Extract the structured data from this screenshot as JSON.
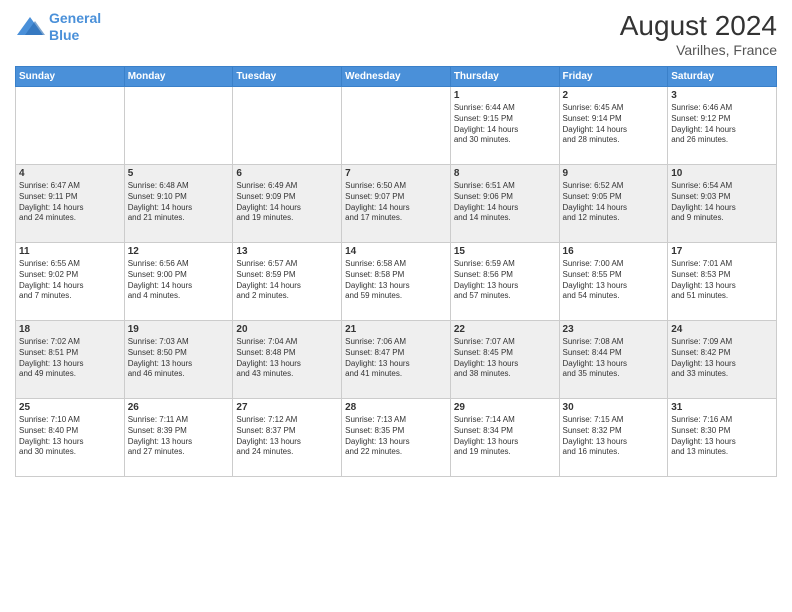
{
  "header": {
    "logo_line1": "General",
    "logo_line2": "Blue",
    "month_year": "August 2024",
    "location": "Varilhes, France"
  },
  "days_of_week": [
    "Sunday",
    "Monday",
    "Tuesday",
    "Wednesday",
    "Thursday",
    "Friday",
    "Saturday"
  ],
  "weeks": [
    [
      {
        "day": "",
        "info": ""
      },
      {
        "day": "",
        "info": ""
      },
      {
        "day": "",
        "info": ""
      },
      {
        "day": "",
        "info": ""
      },
      {
        "day": "1",
        "info": "Sunrise: 6:44 AM\nSunset: 9:15 PM\nDaylight: 14 hours\nand 30 minutes."
      },
      {
        "day": "2",
        "info": "Sunrise: 6:45 AM\nSunset: 9:14 PM\nDaylight: 14 hours\nand 28 minutes."
      },
      {
        "day": "3",
        "info": "Sunrise: 6:46 AM\nSunset: 9:12 PM\nDaylight: 14 hours\nand 26 minutes."
      }
    ],
    [
      {
        "day": "4",
        "info": "Sunrise: 6:47 AM\nSunset: 9:11 PM\nDaylight: 14 hours\nand 24 minutes."
      },
      {
        "day": "5",
        "info": "Sunrise: 6:48 AM\nSunset: 9:10 PM\nDaylight: 14 hours\nand 21 minutes."
      },
      {
        "day": "6",
        "info": "Sunrise: 6:49 AM\nSunset: 9:09 PM\nDaylight: 14 hours\nand 19 minutes."
      },
      {
        "day": "7",
        "info": "Sunrise: 6:50 AM\nSunset: 9:07 PM\nDaylight: 14 hours\nand 17 minutes."
      },
      {
        "day": "8",
        "info": "Sunrise: 6:51 AM\nSunset: 9:06 PM\nDaylight: 14 hours\nand 14 minutes."
      },
      {
        "day": "9",
        "info": "Sunrise: 6:52 AM\nSunset: 9:05 PM\nDaylight: 14 hours\nand 12 minutes."
      },
      {
        "day": "10",
        "info": "Sunrise: 6:54 AM\nSunset: 9:03 PM\nDaylight: 14 hours\nand 9 minutes."
      }
    ],
    [
      {
        "day": "11",
        "info": "Sunrise: 6:55 AM\nSunset: 9:02 PM\nDaylight: 14 hours\nand 7 minutes."
      },
      {
        "day": "12",
        "info": "Sunrise: 6:56 AM\nSunset: 9:00 PM\nDaylight: 14 hours\nand 4 minutes."
      },
      {
        "day": "13",
        "info": "Sunrise: 6:57 AM\nSunset: 8:59 PM\nDaylight: 14 hours\nand 2 minutes."
      },
      {
        "day": "14",
        "info": "Sunrise: 6:58 AM\nSunset: 8:58 PM\nDaylight: 13 hours\nand 59 minutes."
      },
      {
        "day": "15",
        "info": "Sunrise: 6:59 AM\nSunset: 8:56 PM\nDaylight: 13 hours\nand 57 minutes."
      },
      {
        "day": "16",
        "info": "Sunrise: 7:00 AM\nSunset: 8:55 PM\nDaylight: 13 hours\nand 54 minutes."
      },
      {
        "day": "17",
        "info": "Sunrise: 7:01 AM\nSunset: 8:53 PM\nDaylight: 13 hours\nand 51 minutes."
      }
    ],
    [
      {
        "day": "18",
        "info": "Sunrise: 7:02 AM\nSunset: 8:51 PM\nDaylight: 13 hours\nand 49 minutes."
      },
      {
        "day": "19",
        "info": "Sunrise: 7:03 AM\nSunset: 8:50 PM\nDaylight: 13 hours\nand 46 minutes."
      },
      {
        "day": "20",
        "info": "Sunrise: 7:04 AM\nSunset: 8:48 PM\nDaylight: 13 hours\nand 43 minutes."
      },
      {
        "day": "21",
        "info": "Sunrise: 7:06 AM\nSunset: 8:47 PM\nDaylight: 13 hours\nand 41 minutes."
      },
      {
        "day": "22",
        "info": "Sunrise: 7:07 AM\nSunset: 8:45 PM\nDaylight: 13 hours\nand 38 minutes."
      },
      {
        "day": "23",
        "info": "Sunrise: 7:08 AM\nSunset: 8:44 PM\nDaylight: 13 hours\nand 35 minutes."
      },
      {
        "day": "24",
        "info": "Sunrise: 7:09 AM\nSunset: 8:42 PM\nDaylight: 13 hours\nand 33 minutes."
      }
    ],
    [
      {
        "day": "25",
        "info": "Sunrise: 7:10 AM\nSunset: 8:40 PM\nDaylight: 13 hours\nand 30 minutes."
      },
      {
        "day": "26",
        "info": "Sunrise: 7:11 AM\nSunset: 8:39 PM\nDaylight: 13 hours\nand 27 minutes."
      },
      {
        "day": "27",
        "info": "Sunrise: 7:12 AM\nSunset: 8:37 PM\nDaylight: 13 hours\nand 24 minutes."
      },
      {
        "day": "28",
        "info": "Sunrise: 7:13 AM\nSunset: 8:35 PM\nDaylight: 13 hours\nand 22 minutes."
      },
      {
        "day": "29",
        "info": "Sunrise: 7:14 AM\nSunset: 8:34 PM\nDaylight: 13 hours\nand 19 minutes."
      },
      {
        "day": "30",
        "info": "Sunrise: 7:15 AM\nSunset: 8:32 PM\nDaylight: 13 hours\nand 16 minutes."
      },
      {
        "day": "31",
        "info": "Sunrise: 7:16 AM\nSunset: 8:30 PM\nDaylight: 13 hours\nand 13 minutes."
      }
    ]
  ]
}
